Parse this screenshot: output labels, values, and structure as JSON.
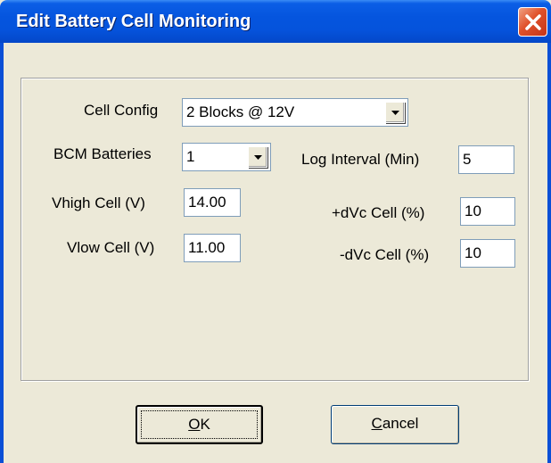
{
  "window": {
    "title": "Edit Battery Cell Monitoring",
    "close_icon": "close-x-icon"
  },
  "form": {
    "cell_config": {
      "label": "Cell Config",
      "value": "2 Blocks @ 12V"
    },
    "bcm_batteries": {
      "label": "BCM Batteries",
      "value": "1"
    },
    "log_interval": {
      "label": "Log Interval (Min)",
      "value": "5"
    },
    "vhigh_cell": {
      "label": "Vhigh Cell (V)",
      "value": "14.00"
    },
    "vlow_cell": {
      "label": "Vlow Cell (V)",
      "value": "11.00"
    },
    "plus_dvc_cell": {
      "label": "+dVc Cell (%)",
      "value": "10"
    },
    "minus_dvc_cell": {
      "label": "-dVc Cell (%)",
      "value": "10"
    }
  },
  "buttons": {
    "ok": {
      "accel": "O",
      "rest": "K"
    },
    "cancel": {
      "accel": "C",
      "rest": "ancel"
    }
  },
  "colors": {
    "titlebar": "#0555de",
    "dialog_bg": "#ece9d8",
    "close_button": "#e0512a"
  }
}
